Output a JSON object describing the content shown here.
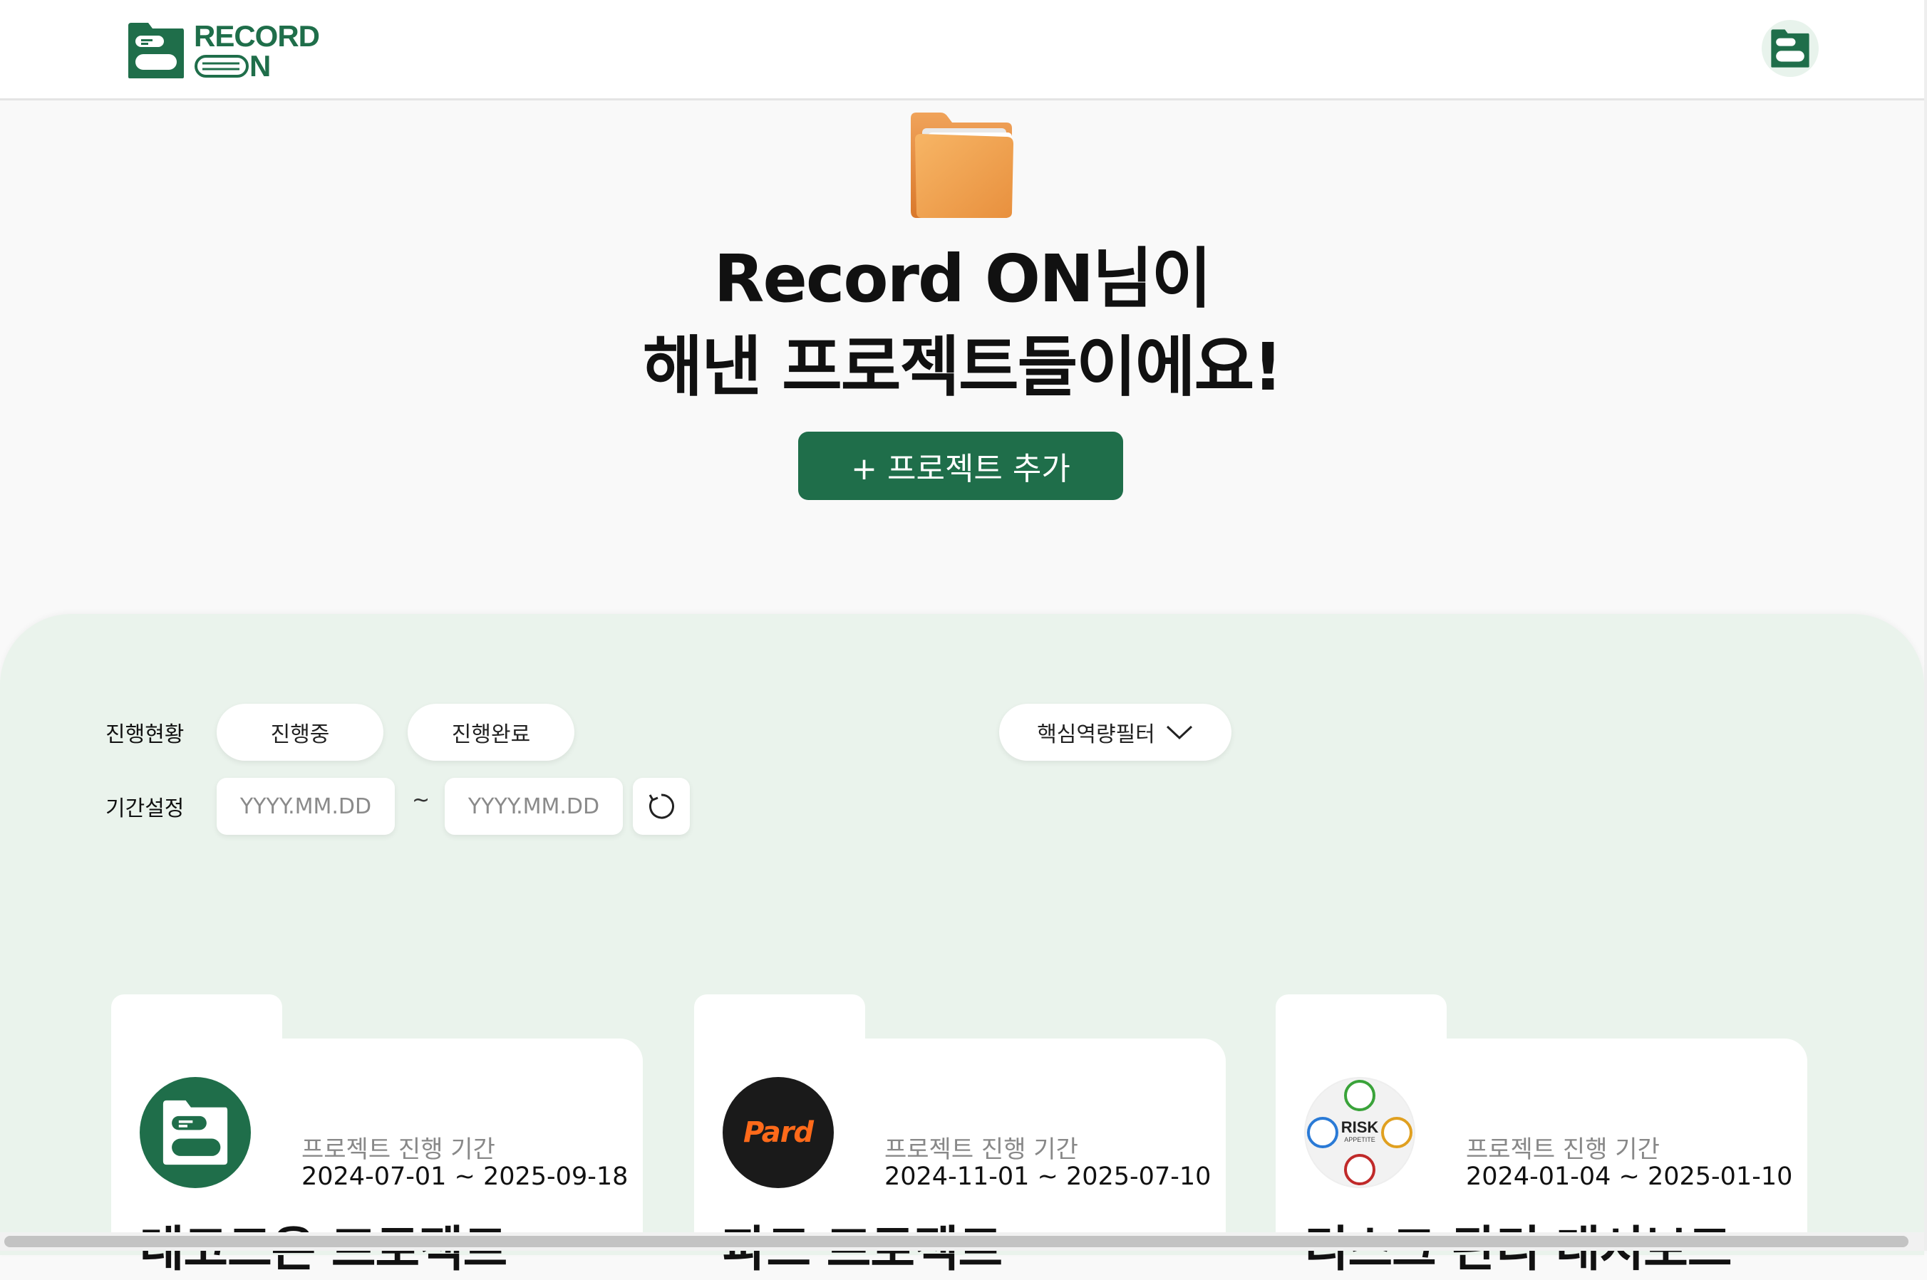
{
  "brand": {
    "logo_line1": "RECORD",
    "logo_line2": "N",
    "accent": "#1f6e4a"
  },
  "header": {
    "profile_icon": "record-on-folder-icon"
  },
  "hero": {
    "title_line1": "Record ON님이",
    "title_line2": "해낸 프로젝트들이에요!",
    "add_button": "+ 프로젝트 추가"
  },
  "filters": {
    "status_label": "진행현황",
    "status_options": [
      "진행중",
      "진행완료"
    ],
    "competency_filter": "핵심역량필터",
    "period_label": "기간설정",
    "start_placeholder": "YYYY.MM.DD",
    "separator": "~",
    "end_placeholder": "YYYY.MM.DD"
  },
  "projects": [
    {
      "period_label": "프로젝트 진행 기간",
      "period": "2024-07-01 ~ 2025-09-18",
      "title": "레코드온 프로젝트",
      "thumb": "record-on-logo"
    },
    {
      "period_label": "프로젝트 진행 기간",
      "period": "2024-11-01 ~ 2025-07-10",
      "title": "파드 프로젝트",
      "thumb": "pard-logo",
      "thumb_text": "Pard"
    },
    {
      "period_label": "프로젝트 진행 기간",
      "period": "2024-01-04 ~ 2025-01-10",
      "title": "리스크 관리 대시보드",
      "thumb": "risk-appetite-diagram",
      "thumb_text": "RISK",
      "thumb_subtext": "APPETITE"
    }
  ]
}
